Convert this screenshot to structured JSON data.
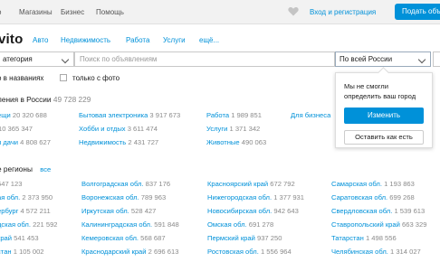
{
  "topbar": {
    "links": [
      "Магазины",
      "Бизнес",
      "Помощь"
    ],
    "first_link_partial": "о",
    "login": "Вход и регистрация",
    "post_button": "Подать объ"
  },
  "brand": {
    "logo": "vito"
  },
  "nav": [
    "Авто",
    "Недвижимость",
    "Работа",
    "Услуги",
    "ещё..."
  ],
  "search": {
    "category": "атегория",
    "placeholder": "Поиск по объявлениям",
    "region": "По всей России",
    "opt_titles": "о в названиях",
    "opt_photo": "только с фото"
  },
  "popup": {
    "message": "Мы не смогли определить ваш город",
    "change_button": "Изменить",
    "keep_button": "Оставить как есть"
  },
  "listings": {
    "title": "ления в России",
    "count": "49 728 229",
    "categories": [
      {
        "label": "ещи",
        "count": "20 320 688"
      },
      {
        "label": "",
        "count": "10 365 347"
      },
      {
        "label": "и дачи",
        "count": "4 808 627"
      },
      {
        "label": "Бытовая электроника",
        "count": "3 917 673"
      },
      {
        "label": "Хобби и отдых",
        "count": "3 611 474"
      },
      {
        "label": "Недвижимость",
        "count": "2 431 727"
      },
      {
        "label": "Работа",
        "count": "1 989 851"
      },
      {
        "label": "Услуги",
        "count": "1 371 342"
      },
      {
        "label": "Животные",
        "count": "490 063"
      },
      {
        "label": "Для бизнеса",
        "count": ""
      }
    ]
  },
  "regions": {
    "title": "е регионы",
    "all_link": "все",
    "items": [
      {
        "label": "",
        "count": "647 123"
      },
      {
        "label": "ая обл.",
        "count": "2 373 950"
      },
      {
        "label": "ербург",
        "count": "4 572 211"
      },
      {
        "label": "дская обл.",
        "count": "221 592"
      },
      {
        "label": "край",
        "count": "541 453"
      },
      {
        "label": "стан",
        "count": "1 105 002"
      },
      {
        "label": "Волгоградская обл.",
        "count": "837 176"
      },
      {
        "label": "Воронежская обл.",
        "count": "789 963"
      },
      {
        "label": "Иркутская обл.",
        "count": "528 427"
      },
      {
        "label": "Калининградская обл.",
        "count": "591 848"
      },
      {
        "label": "Кемеровская обл.",
        "count": "568 687"
      },
      {
        "label": "Краснодарский край",
        "count": "2 696 613"
      },
      {
        "label": "Красноярский край",
        "count": "672 792"
      },
      {
        "label": "Нижегородская обл.",
        "count": "1 377 931"
      },
      {
        "label": "Новосибирская обл.",
        "count": "942 643"
      },
      {
        "label": "Омская обл.",
        "count": "691 278"
      },
      {
        "label": "Пермский край",
        "count": "937 250"
      },
      {
        "label": "Ростовская обл.",
        "count": "1 556 964"
      },
      {
        "label": "Самарская обл.",
        "count": "1 193 863"
      },
      {
        "label": "Саратовская обл.",
        "count": "699 268"
      },
      {
        "label": "Свердловская обл.",
        "count": "1 539 613"
      },
      {
        "label": "Ставропольский край",
        "count": "663 329"
      },
      {
        "label": "Татарстан",
        "count": "1 498 556"
      },
      {
        "label": "Челябинская обл.",
        "count": "1 314 027"
      }
    ]
  },
  "colors": {
    "accent": "#0091d9",
    "muted": "#8a8a8a",
    "topbar": "#f2f2f2"
  }
}
